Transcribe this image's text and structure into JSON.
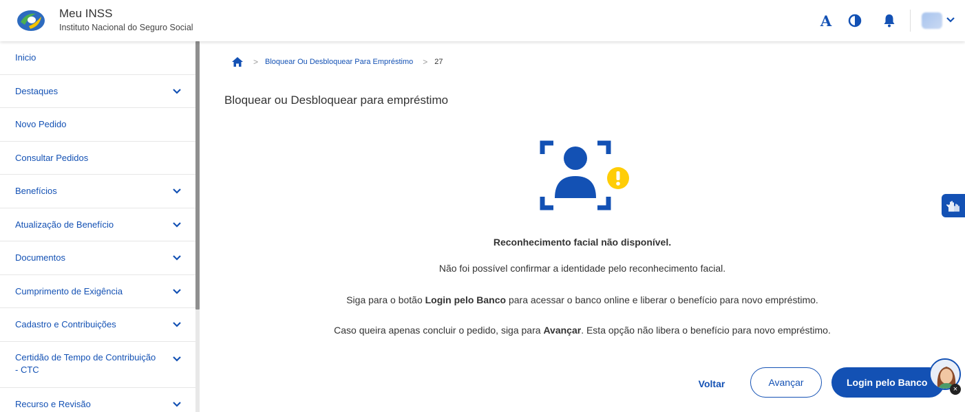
{
  "header": {
    "title": "Meu INSS",
    "subtitle": "Instituto Nacional do Seguro Social",
    "font_icon_label": "A",
    "icons": [
      "font-size-icon",
      "contrast-icon",
      "bell-icon",
      "user-avatar",
      "chevron-down-icon"
    ]
  },
  "sidebar": {
    "items": [
      {
        "label": "Inicio",
        "expandable": false
      },
      {
        "label": "Destaques",
        "expandable": true
      },
      {
        "label": "Novo Pedido",
        "expandable": false
      },
      {
        "label": "Consultar Pedidos",
        "expandable": false
      },
      {
        "label": "Benefícios",
        "expandable": true
      },
      {
        "label": "Atualização de Benefício",
        "expandable": true
      },
      {
        "label": "Documentos",
        "expandable": true
      },
      {
        "label": "Cumprimento de Exigência",
        "expandable": true
      },
      {
        "label": "Cadastro e Contribuições",
        "expandable": true
      },
      {
        "label": "Certidão de Tempo de Contribuição - CTC",
        "expandable": true
      },
      {
        "label": "Recurso e Revisão",
        "expandable": true
      }
    ]
  },
  "breadcrumb": {
    "separator": ">",
    "link": "Bloquear Ou Desbloquear Para Empréstimo",
    "current": "27"
  },
  "main": {
    "title": "Bloquear ou Desbloquear para empréstimo",
    "message_title": "Reconhecimento facial não disponível.",
    "message_1": "Não foi possível confirmar a identidade pelo reconhecimento facial.",
    "message_2_pre": "Siga para o botão ",
    "message_2_bold": "Login pelo Banco",
    "message_2_post": " para acessar o banco online e liberar o benefício para novo empréstimo.",
    "message_3_pre": "Caso queira apenas concluir o pedido, siga para ",
    "message_3_bold": "Avançar",
    "message_3_post": ". Esta opção não libera o benefício para novo empréstimo."
  },
  "actions": {
    "back_label": "Voltar",
    "next_label": "Avançar",
    "bank_login_label": "Login pelo Banco"
  },
  "widgets": {
    "assistant_close": "×"
  },
  "colors": {
    "primary": "#1351b4",
    "warning": "#ffcd07",
    "text": "#333333"
  }
}
